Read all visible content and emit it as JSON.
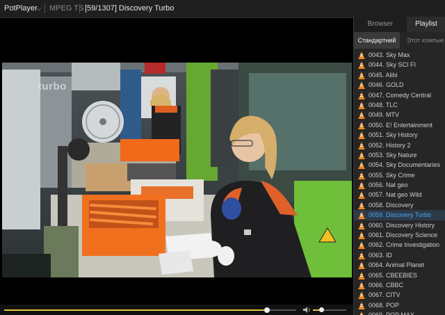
{
  "titlebar": {
    "app_name": "PotPlayer",
    "format": "MPEG TS",
    "title": "[59/1307] Discovery Turbo"
  },
  "video": {
    "watermark": "turbo"
  },
  "controls": {
    "seek_progress": 0.9,
    "volume_level": 0.25
  },
  "panel": {
    "tabs": [
      "Browser",
      "Playlist"
    ],
    "active_tab": "Playlist",
    "subtabs": [
      "Стандартний",
      "Этот компью"
    ],
    "active_subtab": "Стандартний",
    "items": [
      "0043. Sky Max",
      "0044. Sky SCI FI",
      "0045. Alibi",
      "0046. GOLD",
      "0047. Comedy Central",
      "0048. TLC",
      "0049. MTV",
      "0050. E! Entertainment",
      "0051. Sky History",
      "0052. History 2",
      "0053. Sky Nature",
      "0054. Sky Documentaries",
      "0055. Sky Crime",
      "0056. Nat geo",
      "0057. Nat geo Wild",
      "0058. Discovery",
      "0059. Discovery Turbo",
      "0060. Discovery History",
      "0061. Discovery Science",
      "0062. Crime Investigation",
      "0063. ID",
      "0064. Animal Planet",
      "0065. CBEEBIES",
      "0066. CBBC",
      "0067. CITV",
      "0068. POP",
      "0069. POP MAX"
    ],
    "active_index": 16
  },
  "colors": {
    "accent": "#e8c93a",
    "active_item": "#4aa6ff",
    "cone_orange": "#f08a1c"
  }
}
